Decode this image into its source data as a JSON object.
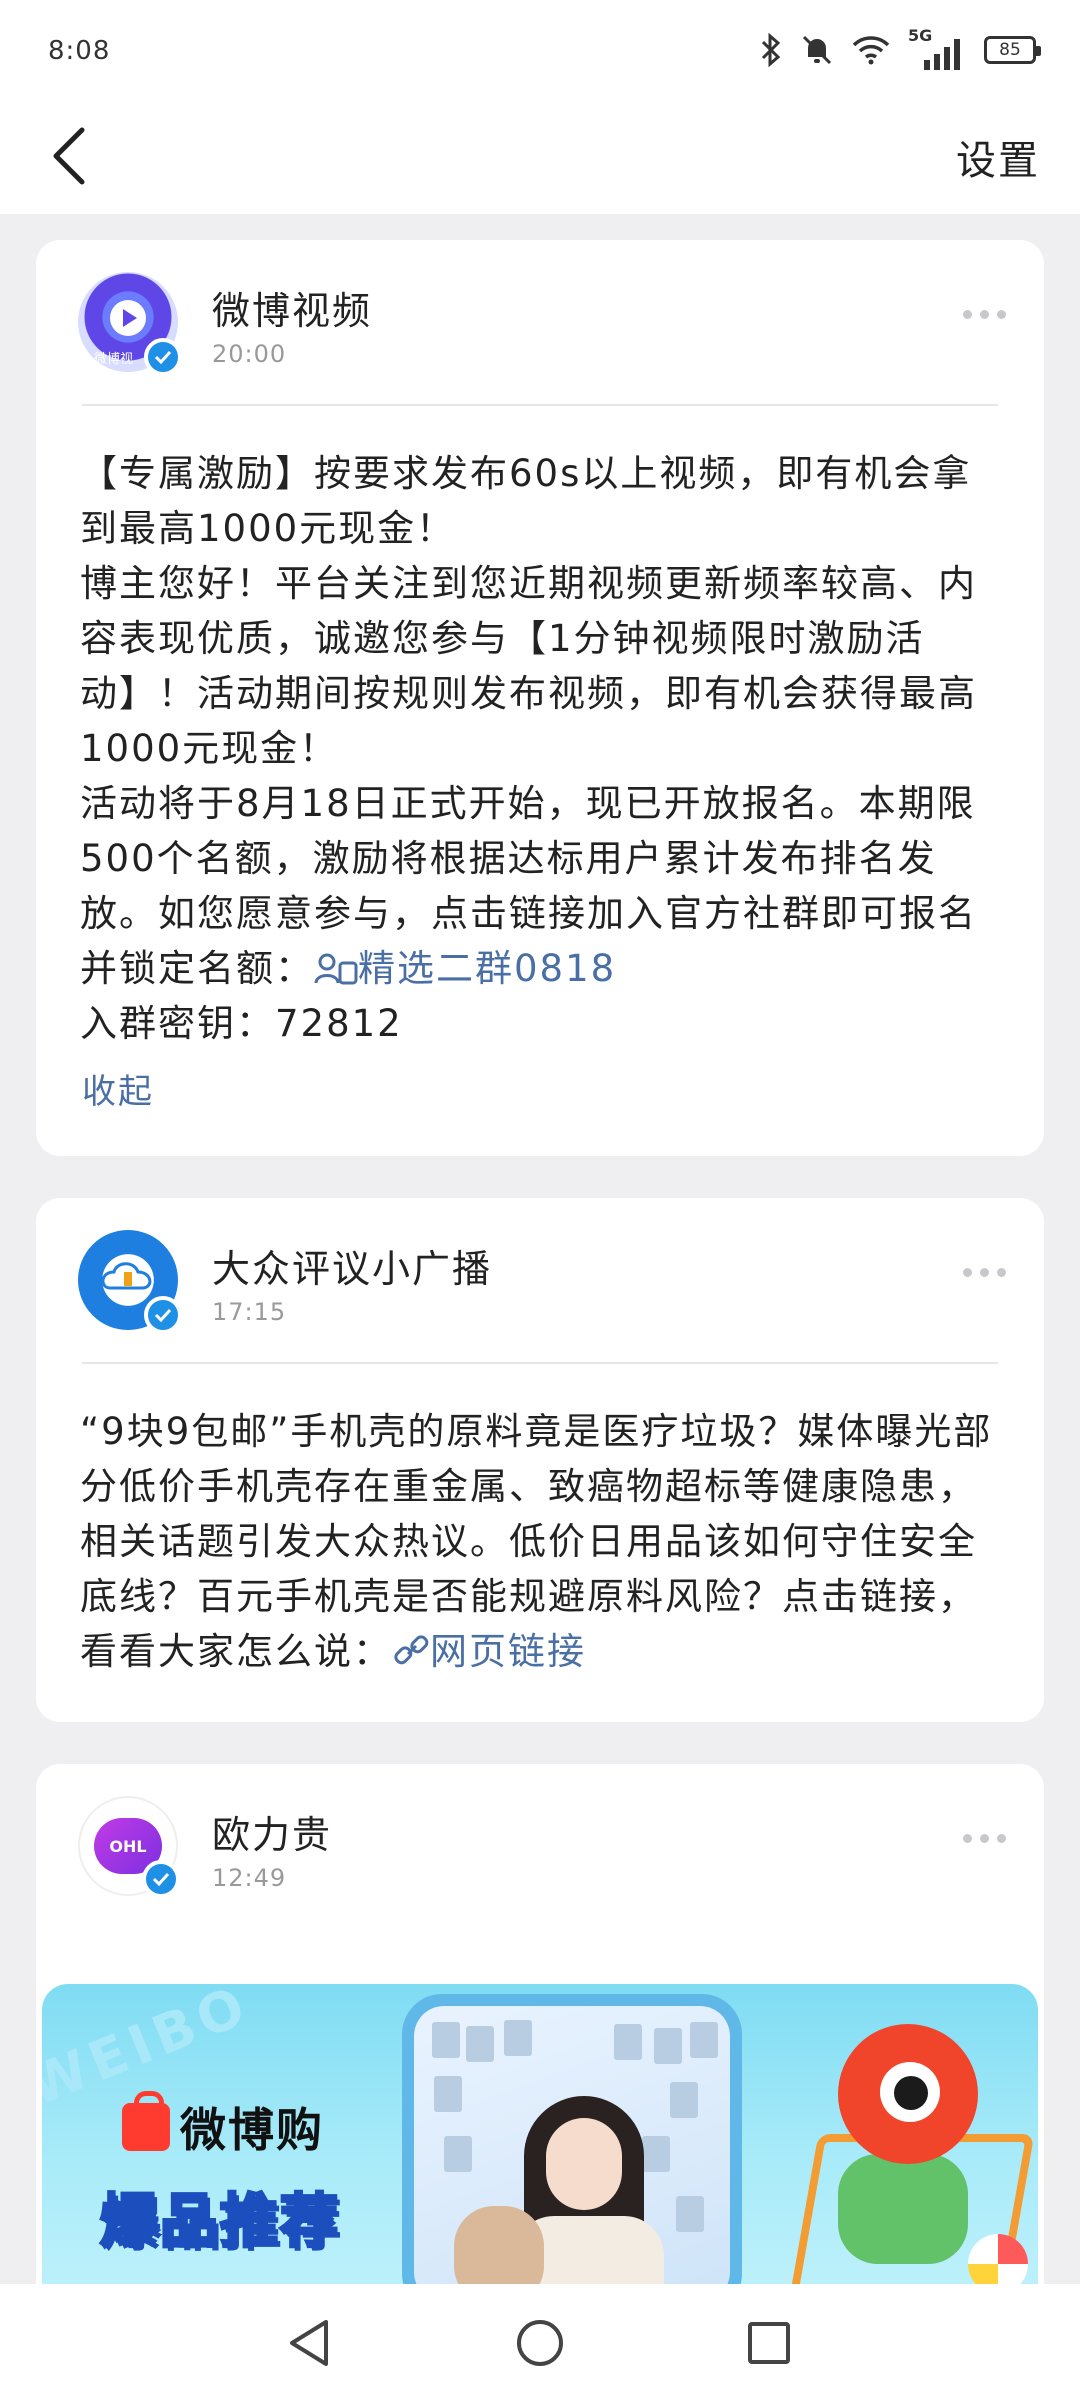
{
  "status_bar": {
    "time": "8:08",
    "battery": "85",
    "network": "5G"
  },
  "nav": {
    "title": "",
    "settings": "设置"
  },
  "posts": [
    {
      "name": "微博视频",
      "time": "20:00",
      "avatar_text": "微博视",
      "text_part1": "【专属激励】按要求发布60s以上视频，即有机会拿到最高1000元现金！",
      "text_part2": "博主您好！平台关注到您近期视频更新频率较高、内容表现优质，诚邀您参与【1分钟视频限时激励活动】！活动期间按规则发布视频，即有机会获得最高1000元现金！",
      "text_part3": "活动将于8月18日正式开始，现已开放报名。本期限500个名额，激励将根据达标用户累计发布排名发放。如您愿意参与，点击链接加入官方社群即可报名并锁定名额：",
      "link_text": "精选二群0818",
      "text_part4": "入群密钥：72812",
      "collapse": "收起"
    },
    {
      "name": "大众评议小广播",
      "time": "17:15",
      "text": "“9块9包邮”手机壳的原料竟是医疗垃圾？媒体曝光部分低价手机壳存在重金属、致癌物超标等健康隐患，相关话题引发大众热议。低价日用品该如何守住安全底线？百元手机壳是否能规避原料风险？点击链接，看看大家怎么说：",
      "link_text": "网页链接"
    },
    {
      "name": "欧力贵",
      "time": "12:49",
      "avatar_text": "OHL",
      "banner": {
        "stripe": "WEIBO",
        "brand": "微博购",
        "headline": "爆品推荐"
      }
    }
  ],
  "colors": {
    "link": "#4a6fa5",
    "verified": "#1e90e6",
    "background": "#efeff1"
  }
}
